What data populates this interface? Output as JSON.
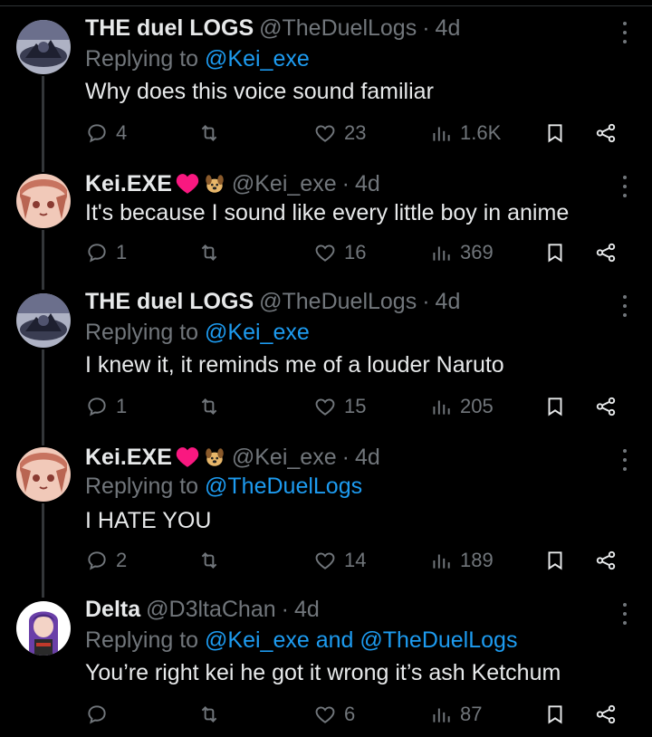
{
  "tweets": [
    {
      "name": "THE duel LOGS",
      "handle": "@TheDuelLogs",
      "time": "4d",
      "replying_prefix": "Replying to ",
      "replying_to": "@Kei_exe",
      "text": "Why does this voice sound familiar",
      "replies": "4",
      "retweets": "",
      "likes": "23",
      "views": "1.6K",
      "avatar": "duel-logs"
    },
    {
      "name": "Kei.EXE",
      "handle": "@Kei_exe",
      "time": "4d",
      "badges": [
        "heart-emoji",
        "dog-emoji"
      ],
      "text": "It's because I sound like every little boy in anime",
      "replies": "1",
      "retweets": "",
      "likes": "16",
      "views": "369",
      "avatar": "kei"
    },
    {
      "name": "THE duel LOGS",
      "handle": "@TheDuelLogs",
      "time": "4d",
      "replying_prefix": "Replying to ",
      "replying_to": "@Kei_exe",
      "text": "I knew it, it reminds me of a louder Naruto",
      "replies": "1",
      "retweets": "",
      "likes": "15",
      "views": "205",
      "avatar": "duel-logs"
    },
    {
      "name": "Kei.EXE",
      "handle": "@Kei_exe",
      "time": "4d",
      "badges": [
        "heart-emoji",
        "dog-emoji"
      ],
      "replying_prefix": "Replying to ",
      "replying_to": "@TheDuelLogs",
      "text": "I HATE YOU",
      "replies": "2",
      "retweets": "",
      "likes": "14",
      "views": "189",
      "avatar": "kei"
    },
    {
      "name": "Delta",
      "handle": "@D3ltaChan",
      "time": "4d",
      "replying_prefix": "Replying to ",
      "replying_to": "@Kei_exe and @TheDuelLogs",
      "text": "You’re right kei he got it wrong it’s ash Ketchum",
      "replies": "",
      "retweets": "",
      "likes": "6",
      "views": "87",
      "avatar": "delta"
    }
  ],
  "colors": {
    "background": "#000000",
    "text": "#e7e9ea",
    "muted": "#71767b",
    "link": "#1d9bf0",
    "heart": "#f91880"
  },
  "icons": [
    "reply-icon",
    "retweet-icon",
    "like-icon",
    "views-icon",
    "bookmark-icon",
    "share-icon",
    "more-icon"
  ]
}
